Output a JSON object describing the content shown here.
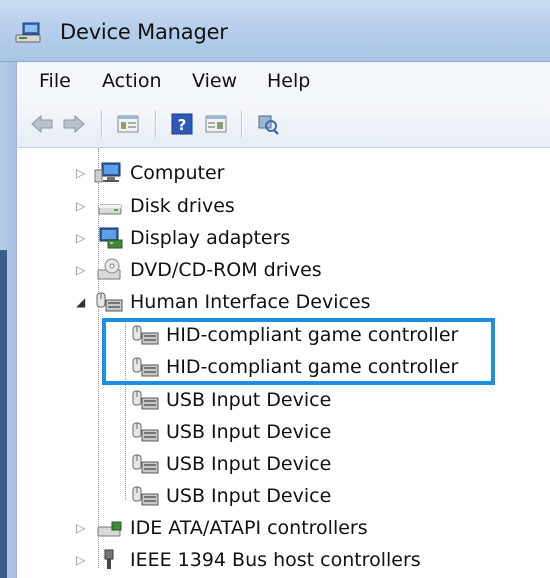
{
  "window": {
    "title": "Device Manager"
  },
  "menu": {
    "items": [
      "File",
      "Action",
      "View",
      "Help"
    ]
  },
  "toolbar": {
    "buttons": [
      "back-arrow-icon",
      "forward-arrow-icon",
      "show-hide-console-tree-icon",
      "help-icon",
      "properties-icon",
      "scan-hardware-icon"
    ]
  },
  "tree": {
    "nodes": [
      {
        "label": "Computer",
        "icon": "computer-icon",
        "expanded": false
      },
      {
        "label": "Disk drives",
        "icon": "disk-drive-icon",
        "expanded": false
      },
      {
        "label": "Display adapters",
        "icon": "display-adapter-icon",
        "expanded": false
      },
      {
        "label": "DVD/CD-ROM drives",
        "icon": "dvd-drive-icon",
        "expanded": false
      },
      {
        "label": "Human Interface Devices",
        "icon": "hid-icon",
        "expanded": true
      },
      {
        "label": "HID-compliant game controller",
        "icon": "hid-device-icon",
        "child": true
      },
      {
        "label": "HID-compliant game controller",
        "icon": "hid-device-icon",
        "child": true
      },
      {
        "label": "USB Input Device",
        "icon": "hid-device-icon",
        "child": true
      },
      {
        "label": "USB Input Device",
        "icon": "hid-device-icon",
        "child": true
      },
      {
        "label": "USB Input Device",
        "icon": "hid-device-icon",
        "child": true
      },
      {
        "label": "USB Input Device",
        "icon": "hid-device-icon",
        "child": true
      },
      {
        "label": "IDE ATA/ATAPI controllers",
        "icon": "ide-controller-icon",
        "expanded": false
      },
      {
        "label": "IEEE 1394 Bus host controllers",
        "icon": "ieee1394-icon",
        "expanded": false
      }
    ]
  },
  "colors": {
    "highlight": "#1a8fe3",
    "titlebar": "#b7cfeb"
  }
}
